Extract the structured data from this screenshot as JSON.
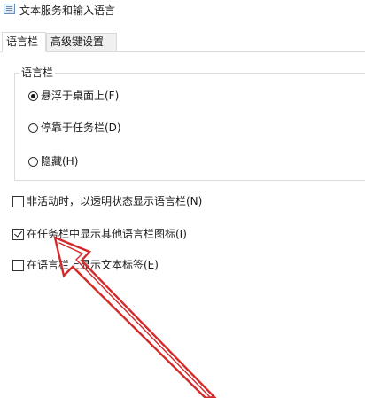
{
  "window": {
    "title": "文本服务和输入语言",
    "icon": "dialog-window-icon"
  },
  "tabs": [
    {
      "label": "语言栏",
      "selected": true
    },
    {
      "label": "高级键设置",
      "selected": false
    }
  ],
  "language_bar_group": {
    "label": "语言栏",
    "options": [
      {
        "label": "悬浮于桌面上(F)",
        "checked": true
      },
      {
        "label": "停靠于任务栏(D)",
        "checked": false
      },
      {
        "label": "隐藏(H)",
        "checked": false
      }
    ]
  },
  "checkboxes": [
    {
      "label": "非活动时，以透明状态显示语言栏(N)",
      "checked": false
    },
    {
      "label": "在任务栏中显示其他语言栏图标(I)",
      "checked": true
    },
    {
      "label": "在语言栏上显示文本标签(E)",
      "checked": false
    }
  ],
  "annotation": {
    "arrow_color": "#d32a2a"
  }
}
